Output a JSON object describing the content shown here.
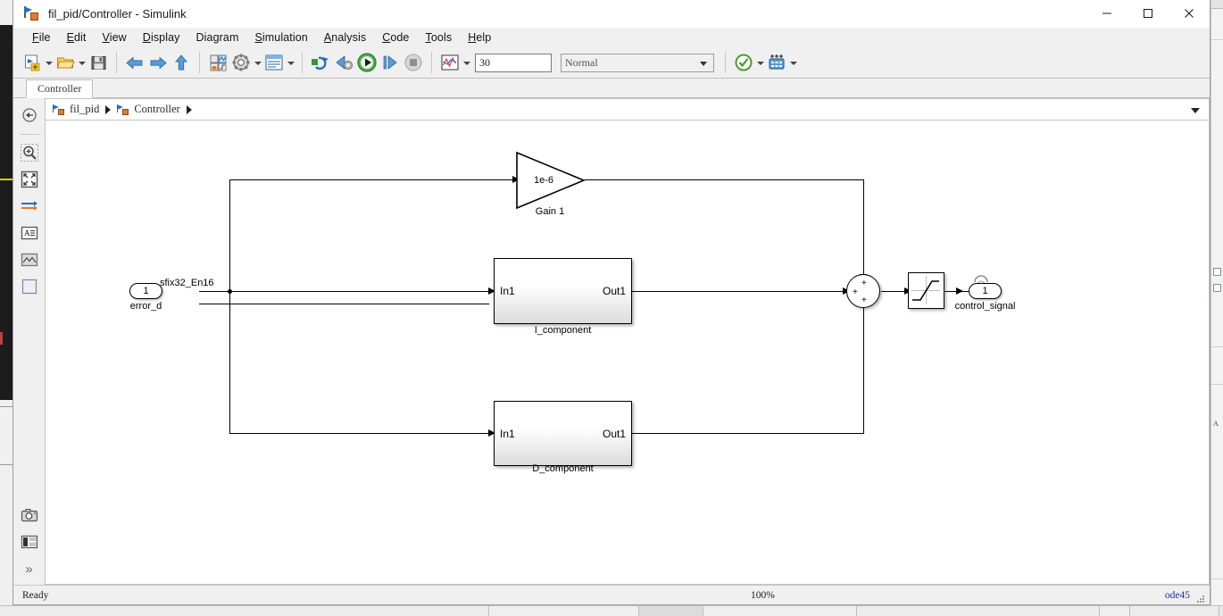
{
  "window": {
    "title": "fil_pid/Controller - Simulink",
    "icon": "simulink-model-icon",
    "controls": {
      "minimize": "minimize-icon",
      "maximize": "maximize-icon",
      "close": "close-icon"
    }
  },
  "menubar": {
    "items": [
      {
        "label": "File",
        "mnemonic": "F"
      },
      {
        "label": "Edit",
        "mnemonic": "E"
      },
      {
        "label": "View",
        "mnemonic": "V"
      },
      {
        "label": "Display",
        "mnemonic": "D"
      },
      {
        "label": "Diagram",
        "mnemonic": "g"
      },
      {
        "label": "Simulation",
        "mnemonic": "S"
      },
      {
        "label": "Analysis",
        "mnemonic": "A"
      },
      {
        "label": "Code",
        "mnemonic": "C"
      },
      {
        "label": "Tools",
        "mnemonic": "T"
      },
      {
        "label": "Help",
        "mnemonic": "H"
      }
    ]
  },
  "toolbar": {
    "buttons": [
      {
        "name": "new-model-icon"
      },
      {
        "name": "open-model-icon"
      },
      {
        "name": "save-icon"
      },
      {
        "name": "back-icon"
      },
      {
        "name": "forward-icon"
      },
      {
        "name": "up-to-parent-icon"
      },
      {
        "name": "library-browser-icon"
      },
      {
        "name": "model-configuration-icon"
      },
      {
        "name": "model-explorer-icon"
      },
      {
        "name": "update-model-icon"
      },
      {
        "name": "step-back-icon"
      },
      {
        "name": "run-icon"
      },
      {
        "name": "step-forward-icon"
      },
      {
        "name": "stop-icon"
      },
      {
        "name": "scope-icon"
      },
      {
        "name": "model-advisor-icon"
      },
      {
        "name": "data-inspector-icon"
      }
    ],
    "simulation_time": "30",
    "simulation_mode": "Normal"
  },
  "tabs": [
    {
      "label": "Controller",
      "active": true
    }
  ],
  "breadcrumb": {
    "back_icon": "back-circle-icon",
    "items": [
      {
        "label": "fil_pid",
        "icon": "model-icon"
      },
      {
        "label": "Controller",
        "icon": "subsystem-icon"
      }
    ],
    "separator": "chevron-right-icon",
    "overflow": "chevron-down-icon"
  },
  "sidebar": {
    "items": [
      {
        "name": "navigate-back-icon",
        "label": "Back"
      },
      {
        "name": "zoom-in-icon",
        "label": "Zoom In"
      },
      {
        "name": "fit-to-view-icon",
        "label": "Fit To View"
      },
      {
        "name": "signals-icon",
        "label": "Signals"
      },
      {
        "name": "annotation-icon",
        "label": "Annotation"
      },
      {
        "name": "image-icon",
        "label": "Image"
      },
      {
        "name": "area-icon",
        "label": "Area"
      }
    ],
    "bottom_items": [
      {
        "name": "camera-icon",
        "label": "Screenshot"
      },
      {
        "name": "legend-icon",
        "label": "Legend"
      },
      {
        "name": "expand-more-icon",
        "label": "More"
      }
    ]
  },
  "diagram": {
    "blocks": [
      {
        "id": "error_d",
        "type": "inport",
        "port_number": "1",
        "label": "error_d"
      },
      {
        "id": "gain1",
        "type": "gain",
        "value": "1e-6",
        "label": "Gain 1"
      },
      {
        "id": "i_component",
        "type": "subsystem",
        "label": "I_component",
        "in_port": "In1",
        "out_port": "Out1"
      },
      {
        "id": "d_component",
        "type": "subsystem",
        "label": "D_component",
        "in_port": "In1",
        "out_port": "Out1"
      },
      {
        "id": "sum",
        "type": "sum",
        "signs": [
          "+",
          "+",
          "+"
        ]
      },
      {
        "id": "saturation",
        "type": "saturation",
        "label": ""
      },
      {
        "id": "control_signal",
        "type": "outport",
        "port_number": "1",
        "label": "control_signal"
      }
    ],
    "signal_labels": [
      {
        "text": "sfix32_En16",
        "for": "error_d"
      }
    ]
  },
  "statusbar": {
    "message": "Ready",
    "zoom": "100%",
    "solver": "ode45"
  }
}
